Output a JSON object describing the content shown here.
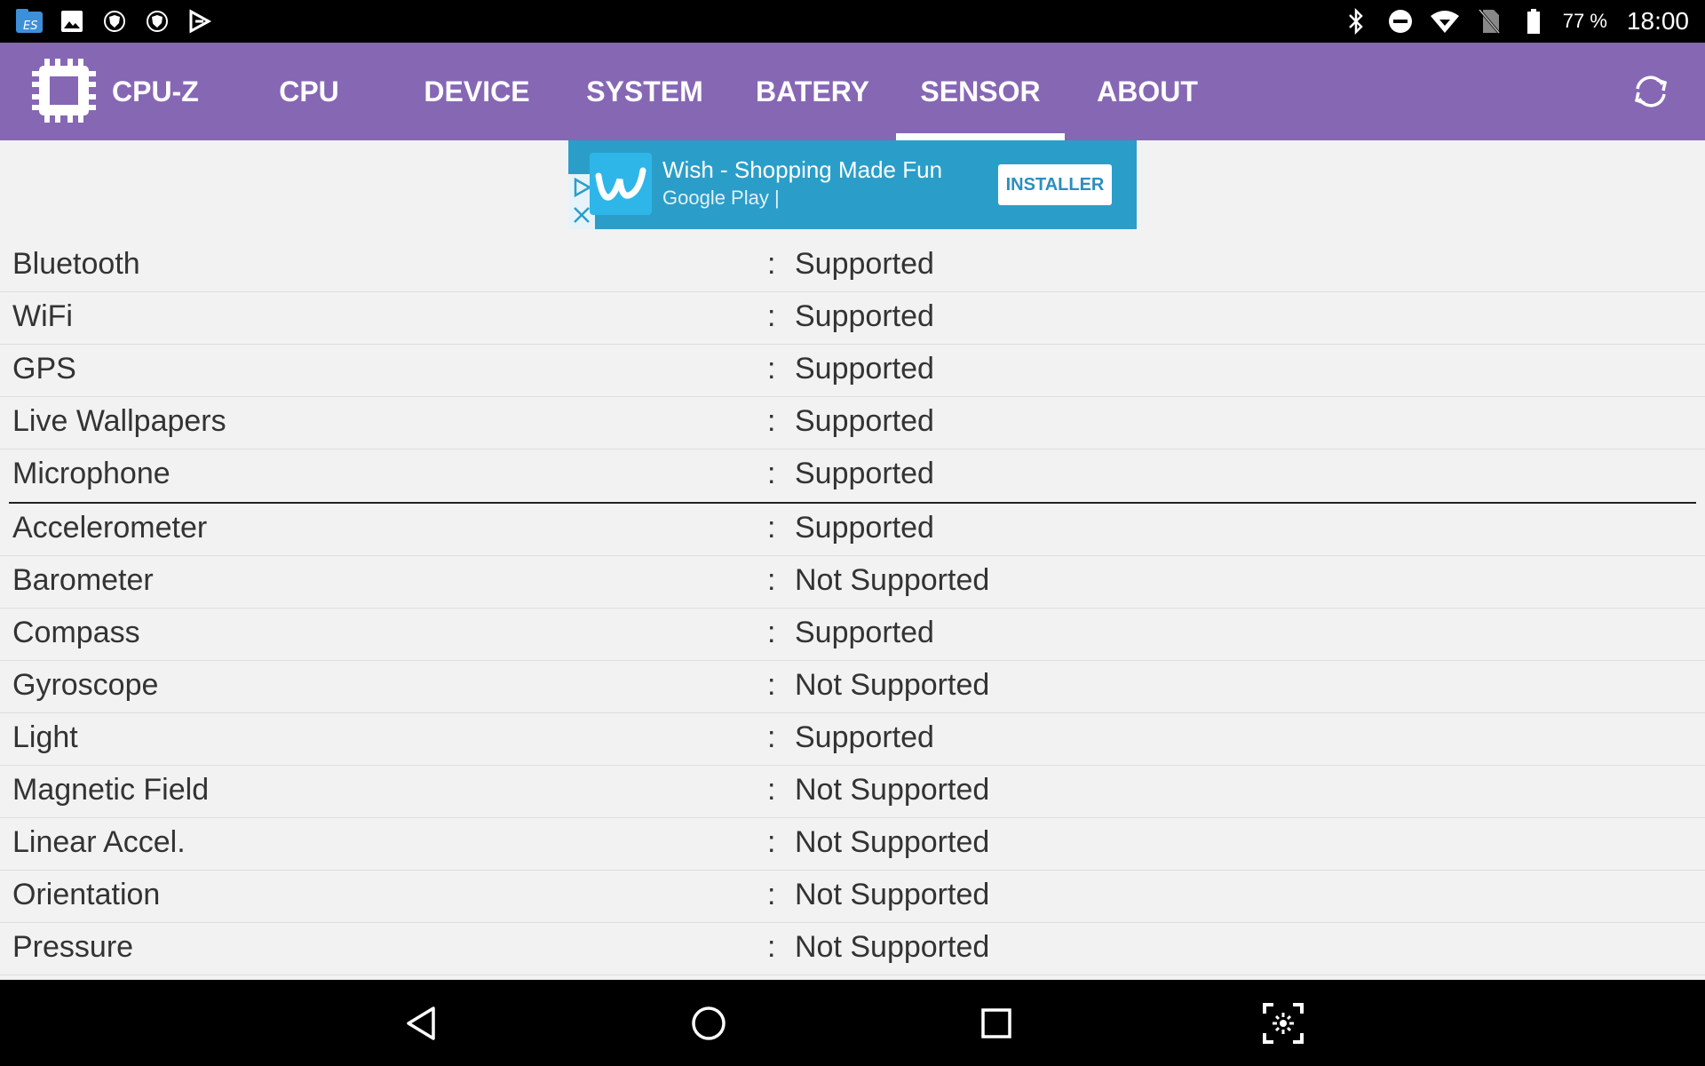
{
  "status_bar": {
    "left_icons": [
      "file-manager-icon",
      "gallery-icon",
      "shield-icon",
      "shield-icon",
      "play-store-icon"
    ],
    "right_icons": [
      "bluetooth-icon",
      "do-not-disturb-icon",
      "wifi-icon",
      "no-sim-icon",
      "battery-icon"
    ],
    "battery": "77 %",
    "time": "18:00"
  },
  "app_bar": {
    "title": "CPU-Z",
    "logo_icon": "chip-icon",
    "tabs": [
      {
        "label": "CPU",
        "active": false
      },
      {
        "label": "DEVICE",
        "active": false
      },
      {
        "label": "SYSTEM",
        "active": false
      },
      {
        "label": "BATERY",
        "active": false
      },
      {
        "label": "SENSOR",
        "active": true
      },
      {
        "label": "ABOUT",
        "active": false
      }
    ],
    "refresh_icon": "refresh-icon",
    "color": "#8667b4"
  },
  "ad": {
    "title": "Wish - Shopping Made Fun",
    "subtitle": "Google Play  |",
    "button": "INSTALLER",
    "color": "#2a9ec9"
  },
  "features": [
    {
      "label": "Bluetooth",
      "value": "Supported"
    },
    {
      "label": "WiFi",
      "value": "Supported"
    },
    {
      "label": "GPS",
      "value": "Supported"
    },
    {
      "label": "Live Wallpapers",
      "value": "Supported"
    },
    {
      "label": "Microphone",
      "value": "Supported"
    }
  ],
  "sensors": [
    {
      "label": "Accelerometer",
      "value": "Supported"
    },
    {
      "label": "Barometer",
      "value": "Not Supported"
    },
    {
      "label": "Compass",
      "value": "Supported"
    },
    {
      "label": "Gyroscope",
      "value": "Not Supported"
    },
    {
      "label": "Light",
      "value": "Supported"
    },
    {
      "label": "Magnetic Field",
      "value": "Not Supported"
    },
    {
      "label": "Linear Accel.",
      "value": "Not Supported"
    },
    {
      "label": "Orientation",
      "value": "Not Supported"
    },
    {
      "label": "Pressure",
      "value": "Not Supported"
    }
  ],
  "separator": ":",
  "nav_bar": {
    "buttons": [
      "back-icon",
      "home-icon",
      "recents-icon",
      "screenshot-icon"
    ]
  }
}
